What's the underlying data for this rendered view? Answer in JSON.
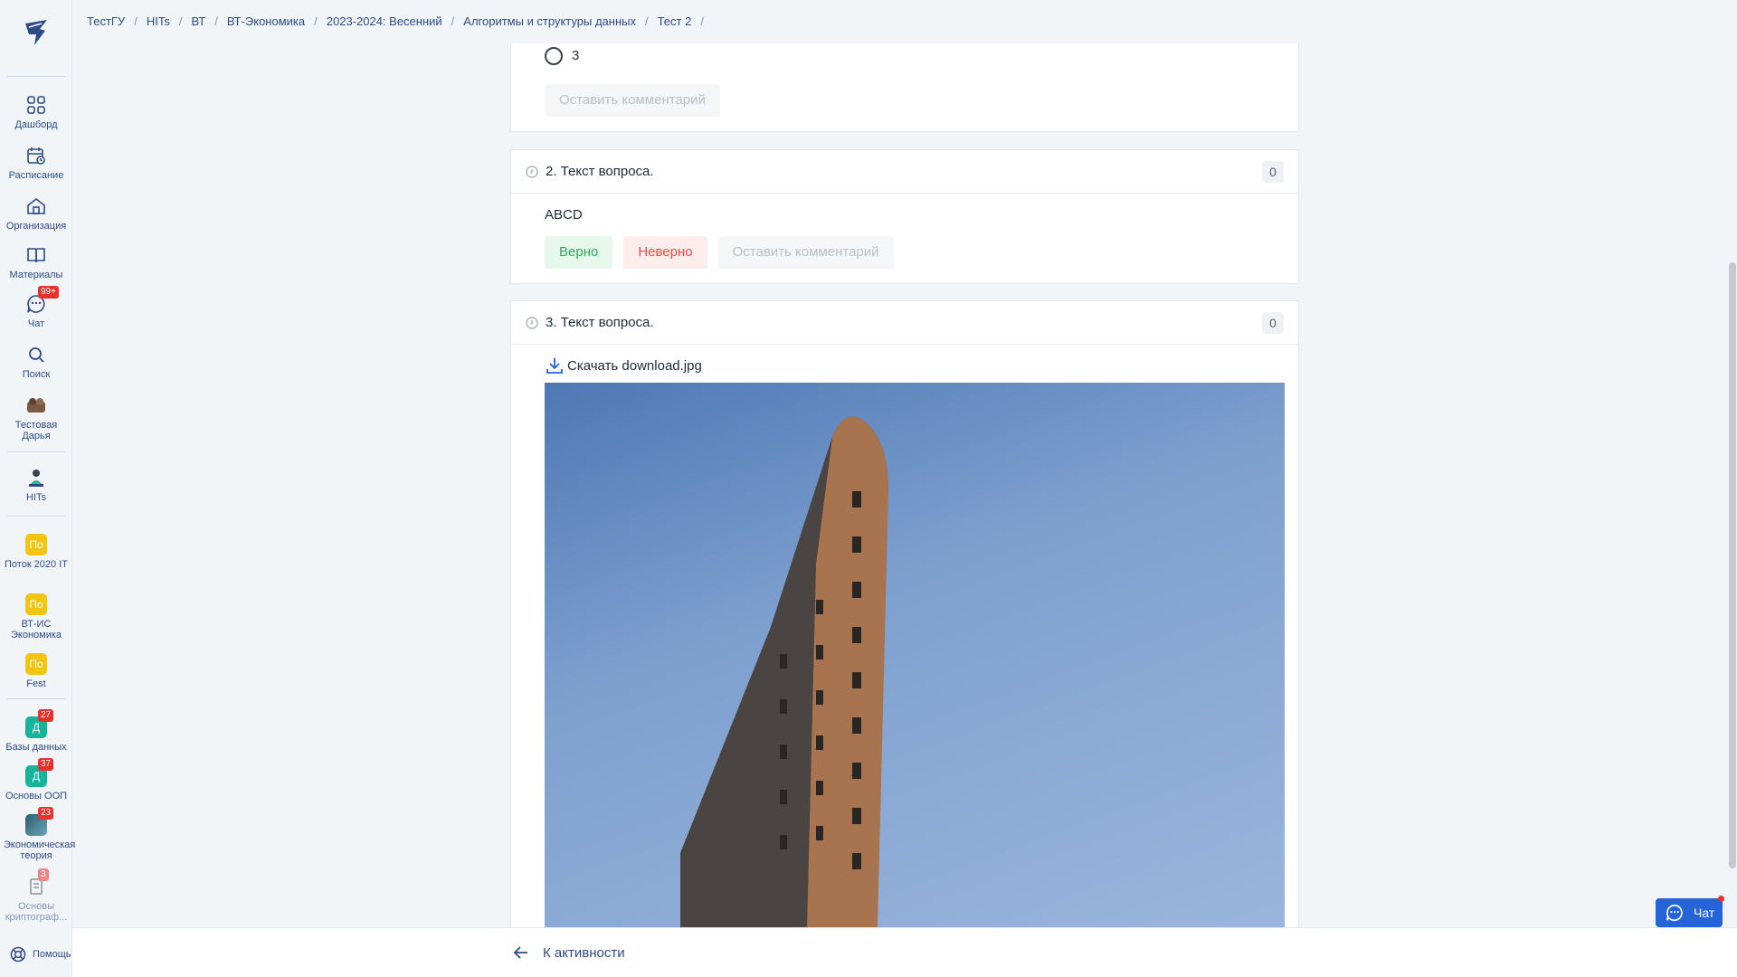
{
  "sidebar": {
    "items": [
      {
        "label": "Дашборд",
        "icon": "dashboard-icon"
      },
      {
        "label": "Расписание",
        "icon": "calendar-icon"
      },
      {
        "label": "Организация",
        "icon": "home-icon"
      },
      {
        "label": "Материалы",
        "icon": "book-icon"
      },
      {
        "label": "Чат",
        "icon": "chat-icon",
        "badge": "99+"
      },
      {
        "label": "Поиск",
        "icon": "search-icon"
      },
      {
        "label": "Тестовая Дарья",
        "icon": "avatar"
      }
    ],
    "orgs": [
      {
        "label": "HITs",
        "icon": "hits-logo"
      }
    ],
    "groups": [
      {
        "label": "Поток 2020 IT",
        "abbr": "По"
      },
      {
        "label": "ВТ-ИС Экономика",
        "abbr": "По"
      },
      {
        "label": "Fest",
        "abbr": "По"
      }
    ],
    "courses": [
      {
        "label": "Базы данных",
        "abbr": "Д",
        "badge": "27"
      },
      {
        "label": "Основы ООП",
        "abbr": "Д",
        "badge": "37"
      },
      {
        "label": "Экономическая теория",
        "abbr": "",
        "badge": "23"
      },
      {
        "label": "Основы криптограф...",
        "abbr": "",
        "badge": "3"
      }
    ],
    "help_label": "Помощь"
  },
  "breadcrumbs": [
    "ТестГУ",
    "HITs",
    "ВТ",
    "ВТ-Экономика",
    "2023-2024: Весенний",
    "Алгоритмы и структуры данных",
    "Тест 2"
  ],
  "question1": {
    "option_label": "3",
    "comment_label": "Оставить комментарий"
  },
  "question2": {
    "title": "2. Текст вопроса.",
    "score": "0",
    "answer": "ABCD",
    "correct_label": "Верно",
    "wrong_label": "Неверно",
    "comment_label": "Оставить комментарий"
  },
  "question3": {
    "title": "3. Текст вопроса.",
    "score": "0",
    "download_label": "Скачать download.jpg"
  },
  "footer": {
    "back_label": "К активности"
  },
  "chat_widget": {
    "label": "Чат"
  },
  "colors": {
    "accent": "#2d4a8a",
    "primary_button": "#2563d8",
    "badge": "#e5322d",
    "success": "#2eaa5b",
    "danger": "#e8504a"
  }
}
